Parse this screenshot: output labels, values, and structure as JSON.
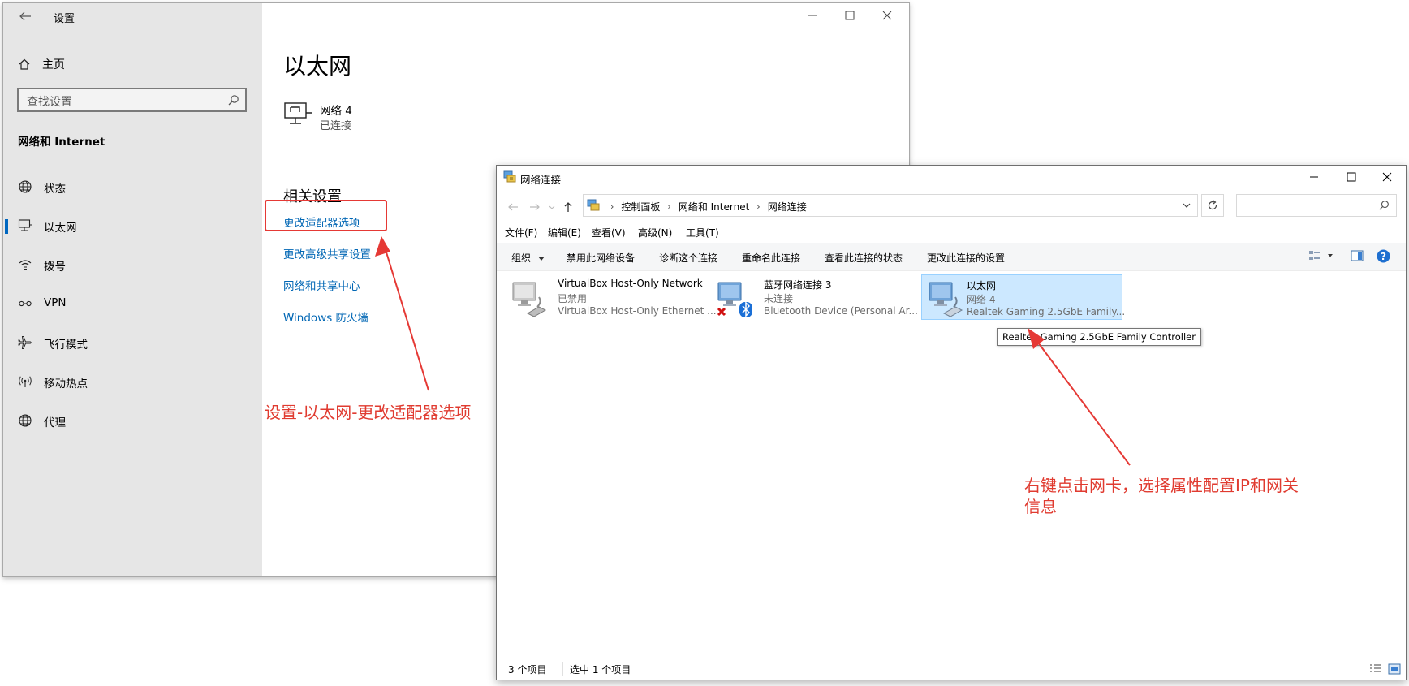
{
  "settings": {
    "title": "设置",
    "home_label": "主页",
    "search_placeholder": "查找设置",
    "section_label": "网络和 Internet",
    "nav_items": [
      {
        "label": "状态",
        "icon": "globe-icon"
      },
      {
        "label": "以太网",
        "icon": "ethernet-icon"
      },
      {
        "label": "拨号",
        "icon": "dialup-icon"
      },
      {
        "label": "VPN",
        "icon": "vpn-icon"
      },
      {
        "label": "飞行模式",
        "icon": "airplane-icon"
      },
      {
        "label": "移动热点",
        "icon": "hotspot-icon"
      },
      {
        "label": "代理",
        "icon": "globe-icon"
      }
    ],
    "active_item": "以太网",
    "page_title": "以太网",
    "network": {
      "name": "网络 4",
      "status": "已连接"
    },
    "related_title": "相关设置",
    "related_links": [
      "更改适配器选项",
      "更改高级共享设置",
      "网络和共享中心",
      "Windows 防火墙"
    ]
  },
  "network_connections": {
    "title": "网络连接",
    "breadcrumbs": [
      "控制面板",
      "网络和 Internet",
      "网络连接"
    ],
    "menu": [
      "文件(F)",
      "编辑(E)",
      "查看(V)",
      "高级(N)",
      "工具(T)"
    ],
    "commands": [
      "组织",
      "禁用此网络设备",
      "诊断这个连接",
      "重命名此连接",
      "查看此连接的状态",
      "更改此连接的设置"
    ],
    "items": [
      {
        "name": "VirtualBox Host-Only Network",
        "status": "已禁用",
        "device": "VirtualBox Host-Only Ethernet ..."
      },
      {
        "name": "蓝牙网络连接 3",
        "status": "未连接",
        "device": "Bluetooth Device (Personal Ar..."
      },
      {
        "name": "以太网",
        "status": "网络 4",
        "device": "Realtek Gaming 2.5GbE Family...",
        "selected": true
      }
    ],
    "tooltip": "Realtek Gaming 2.5GbE Family Controller",
    "status_count": "3 个项目",
    "status_selected": "选中 1 个项目"
  },
  "annotations": {
    "label1": "设置-以太网-更改适配器选项",
    "label2_line1": "右键点击网卡，选择属性配置IP和网关",
    "label2_line2": "信息",
    "color": "#e03b30"
  }
}
